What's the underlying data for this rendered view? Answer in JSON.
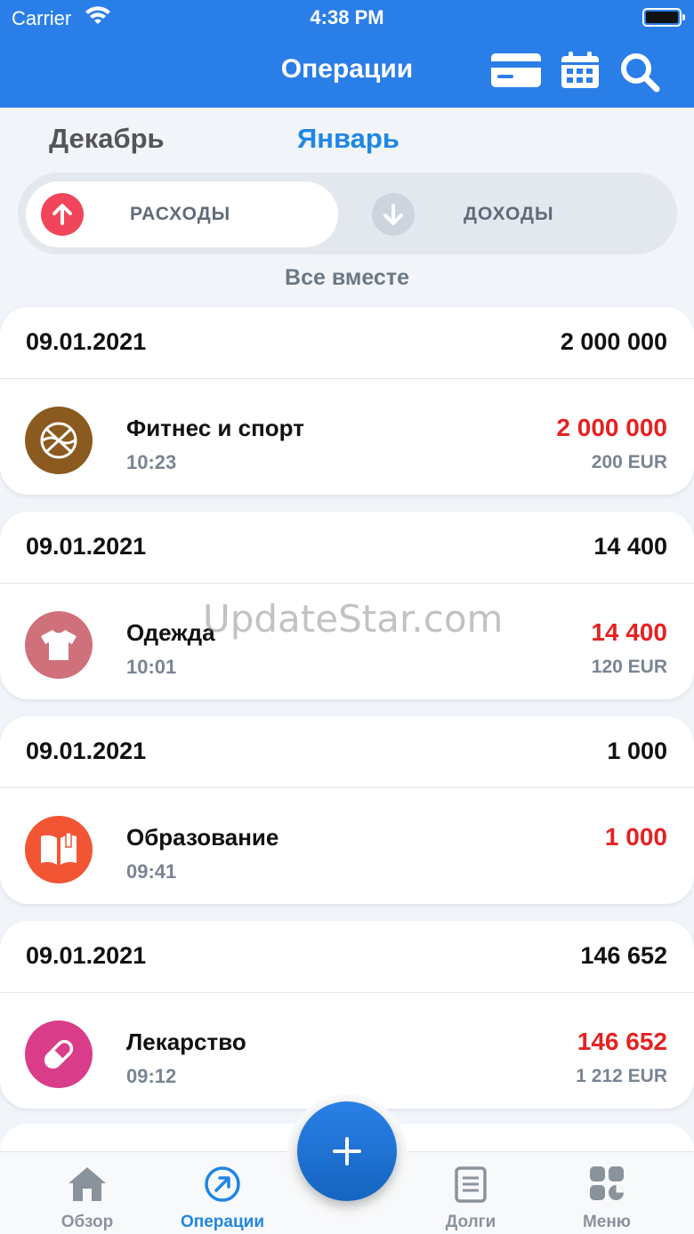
{
  "status": {
    "carrier": "Carrier",
    "time": "4:38 PM"
  },
  "header": {
    "title": "Операции",
    "icons": [
      "card-icon",
      "calendar-icon",
      "search-icon"
    ]
  },
  "months": {
    "prev": "Декабрь",
    "current": "Январь"
  },
  "segment": {
    "expenses": "РАСХОДЫ",
    "income": "ДОХОДЫ",
    "active": "expenses"
  },
  "subtitle": "Все вместе",
  "groups": [
    {
      "date": "09.01.2021",
      "total": "2 000 000",
      "category": "Фитнес и спорт",
      "time": "10:23",
      "amount": "2 000 000",
      "amount_eur": "200 EUR",
      "icon": "basketball-icon",
      "color": "#8a5a1e"
    },
    {
      "date": "09.01.2021",
      "total": "14 400",
      "category": "Одежда",
      "time": "10:01",
      "amount": "14 400",
      "amount_eur": "120 EUR",
      "icon": "tshirt-icon",
      "color": "#d0707a"
    },
    {
      "date": "09.01.2021",
      "total": "1 000",
      "category": "Образование",
      "time": "09:41",
      "amount": "1 000",
      "amount_eur": "",
      "icon": "book-icon",
      "color": "#f25534"
    },
    {
      "date": "09.01.2021",
      "total": "146 652",
      "category": "Лекарство",
      "time": "09:12",
      "amount": "146 652",
      "amount_eur": "1 212 EUR",
      "icon": "pill-icon",
      "color": "#d93d8a"
    }
  ],
  "watermark": "UpdateStar.com",
  "tabbar": {
    "items": [
      {
        "label": "Обзор",
        "icon": "home-icon"
      },
      {
        "label": "Операции",
        "icon": "operations-icon"
      },
      {
        "label": "Долги",
        "icon": "debts-icon"
      },
      {
        "label": "Меню",
        "icon": "menu-icon"
      }
    ],
    "active": "Операции"
  },
  "colors": {
    "accent": "#2a7ee8",
    "expense": "#e42222",
    "expense_button": "#f0455a"
  }
}
